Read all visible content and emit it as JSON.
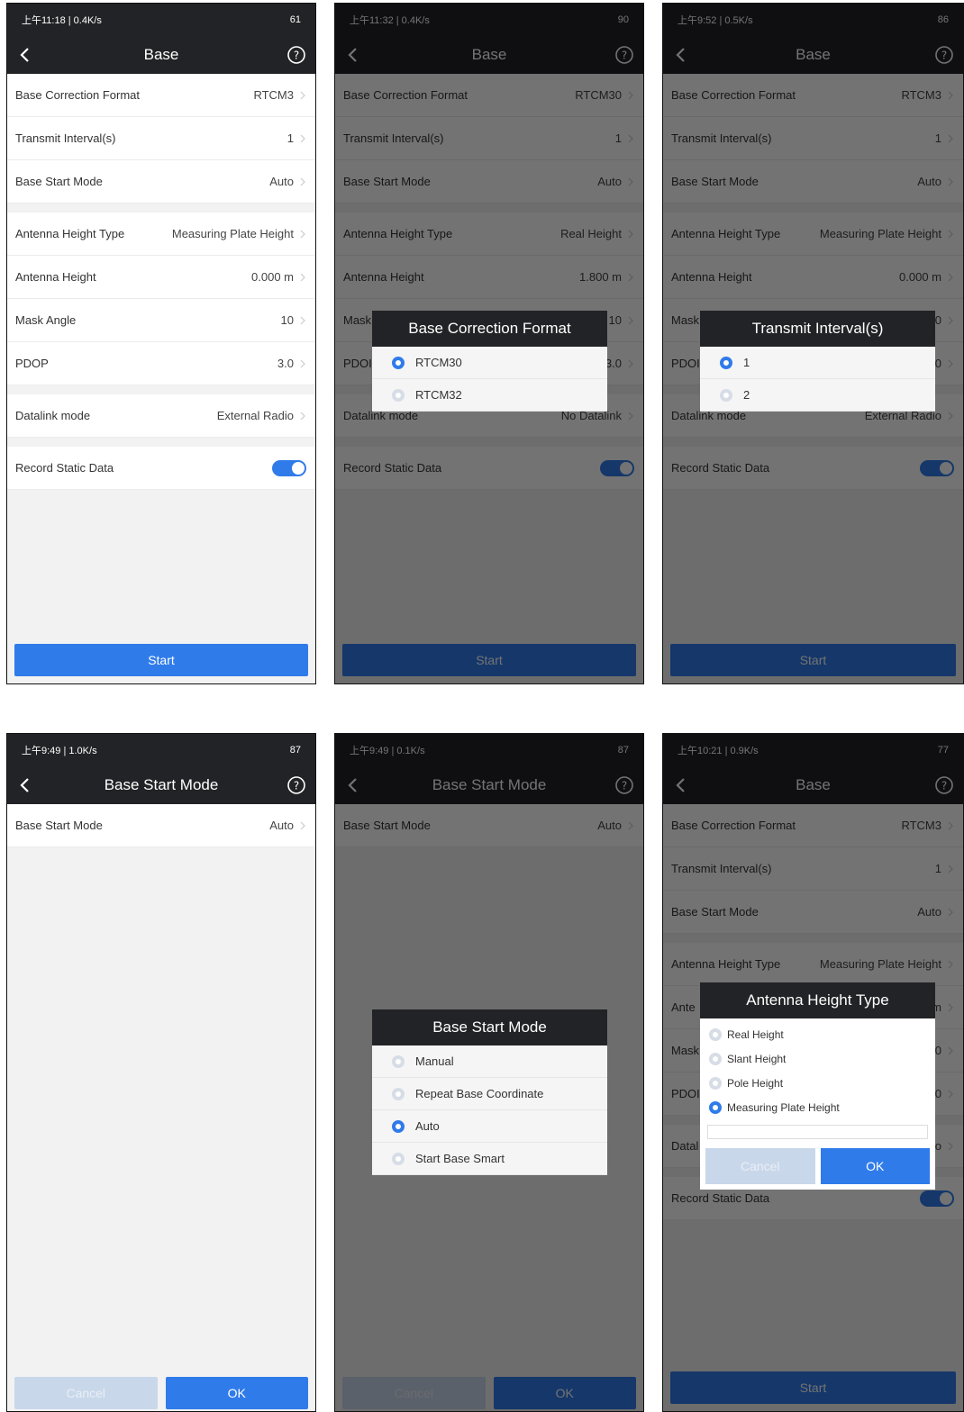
{
  "status": {
    "p1": {
      "left": "上午11:18 | 0.4K/s",
      "battery": "61"
    },
    "p2": {
      "left": "上午11:32 | 0.4K/s",
      "battery": "90"
    },
    "p3": {
      "left": "上午9:52 | 0.5K/s",
      "battery": "86"
    },
    "p4": {
      "left": "上午9:49 | 1.0K/s",
      "battery": "87"
    },
    "p5": {
      "left": "上午9:49 | 0.1K/s",
      "battery": "87"
    },
    "p6": {
      "left": "上午10:21 | 0.9K/s",
      "battery": "77"
    }
  },
  "titles": {
    "base": "Base",
    "base_start_mode": "Base Start Mode"
  },
  "labels": {
    "correction_format": "Base Correction Format",
    "transmit_interval": "Transmit Interval(s)",
    "start_mode": "Base Start Mode",
    "antenna_height_type": "Antenna Height Type",
    "antenna_height": "Antenna Height",
    "mask_angle": "Mask Angle",
    "pdop": "PDOP",
    "datalink_mode": "Datalink mode",
    "record_static": "Record Static Data"
  },
  "p1": {
    "correction_format": "RTCM3",
    "transmit_interval": "1",
    "start_mode": "Auto",
    "antenna_height_type": "Measuring Plate Height",
    "antenna_height": "0.000 m",
    "mask_angle": "10",
    "pdop": "3.0",
    "datalink_mode": "External Radio"
  },
  "p2": {
    "correction_format": "RTCM30",
    "transmit_interval": "1",
    "start_mode": "Auto",
    "antenna_height_type": "Real Height",
    "antenna_height": "1.800 m",
    "mask_angle": "10",
    "pdop": "3.0",
    "datalink_mode": "No Datalink"
  },
  "p3": {
    "correction_format": "RTCM3",
    "transmit_interval": "1",
    "start_mode": "Auto",
    "antenna_height_type": "Measuring Plate Height",
    "antenna_height": "0.000 m",
    "mask_angle": "10",
    "pdop": "3.0",
    "datalink_mode": "External Radio"
  },
  "p4": {
    "start_mode": "Auto"
  },
  "p5": {
    "start_mode": "Auto"
  },
  "p6": {
    "correction_format": "RTCM3",
    "transmit_interval": "1",
    "start_mode": "Auto",
    "antenna_height_type": "Measuring Plate Height",
    "antenna_height": "m",
    "mask_angle": "10",
    "pdop": "3.0",
    "datalink_mode": "io"
  },
  "truncated": {
    "mask": "Mask",
    "pdop": "PDOI",
    "ante": "Ante",
    "datal": "Datal",
    "pdoi6": "PDOI"
  },
  "buttons": {
    "start": "Start",
    "cancel": "Cancel",
    "ok": "OK"
  },
  "dialogs": {
    "correction": {
      "title": "Base Correction Format",
      "options": [
        "RTCM30",
        "RTCM32"
      ],
      "selected": 0
    },
    "interval": {
      "title": "Transmit Interval(s)",
      "options": [
        "1",
        "2"
      ],
      "selected": 0
    },
    "start_mode": {
      "title": "Base Start Mode",
      "options": [
        "Manual",
        "Repeat Base Coordinate",
        "Auto",
        "Start Base Smart"
      ],
      "selected": 2
    },
    "height_type": {
      "title": "Antenna Height Type",
      "options": [
        "Real Height",
        "Slant Height",
        "Pole Height",
        "Measuring Plate Height"
      ],
      "selected": 3
    }
  },
  "colors": {
    "accent": "#2f7bea",
    "bar": "#222326"
  }
}
